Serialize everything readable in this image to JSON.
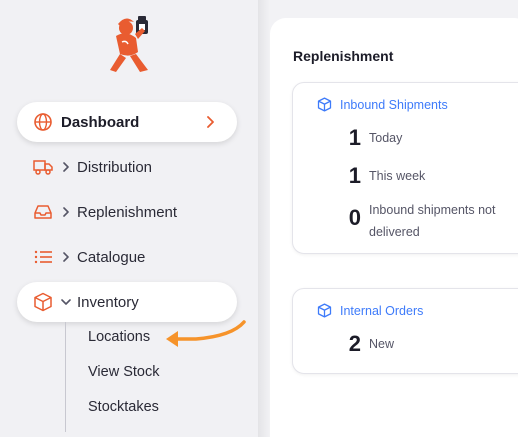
{
  "sidebar": {
    "items": [
      {
        "label": "Dashboard",
        "icon": "globe-icon"
      },
      {
        "label": "Distribution",
        "icon": "truck-icon"
      },
      {
        "label": "Replenishment",
        "icon": "inbox-icon"
      },
      {
        "label": "Catalogue",
        "icon": "list-icon"
      },
      {
        "label": "Inventory",
        "icon": "box-icon"
      }
    ],
    "inventory_sub": [
      "Locations",
      "View Stock",
      "Stocktakes"
    ]
  },
  "main": {
    "section_title": "Replenishment",
    "inbound": {
      "title": "Inbound Shipments",
      "rows": [
        {
          "value": "1",
          "label": "Today"
        },
        {
          "value": "1",
          "label": "This week"
        },
        {
          "value": "0",
          "label": "Inbound shipments not delivered"
        }
      ]
    },
    "internal": {
      "title": "Internal Orders",
      "rows": [
        {
          "value": "2",
          "label": "New"
        }
      ]
    }
  },
  "colors": {
    "accent": "#e95c30",
    "link": "#3e7bfa",
    "arrow": "#f6932a"
  }
}
